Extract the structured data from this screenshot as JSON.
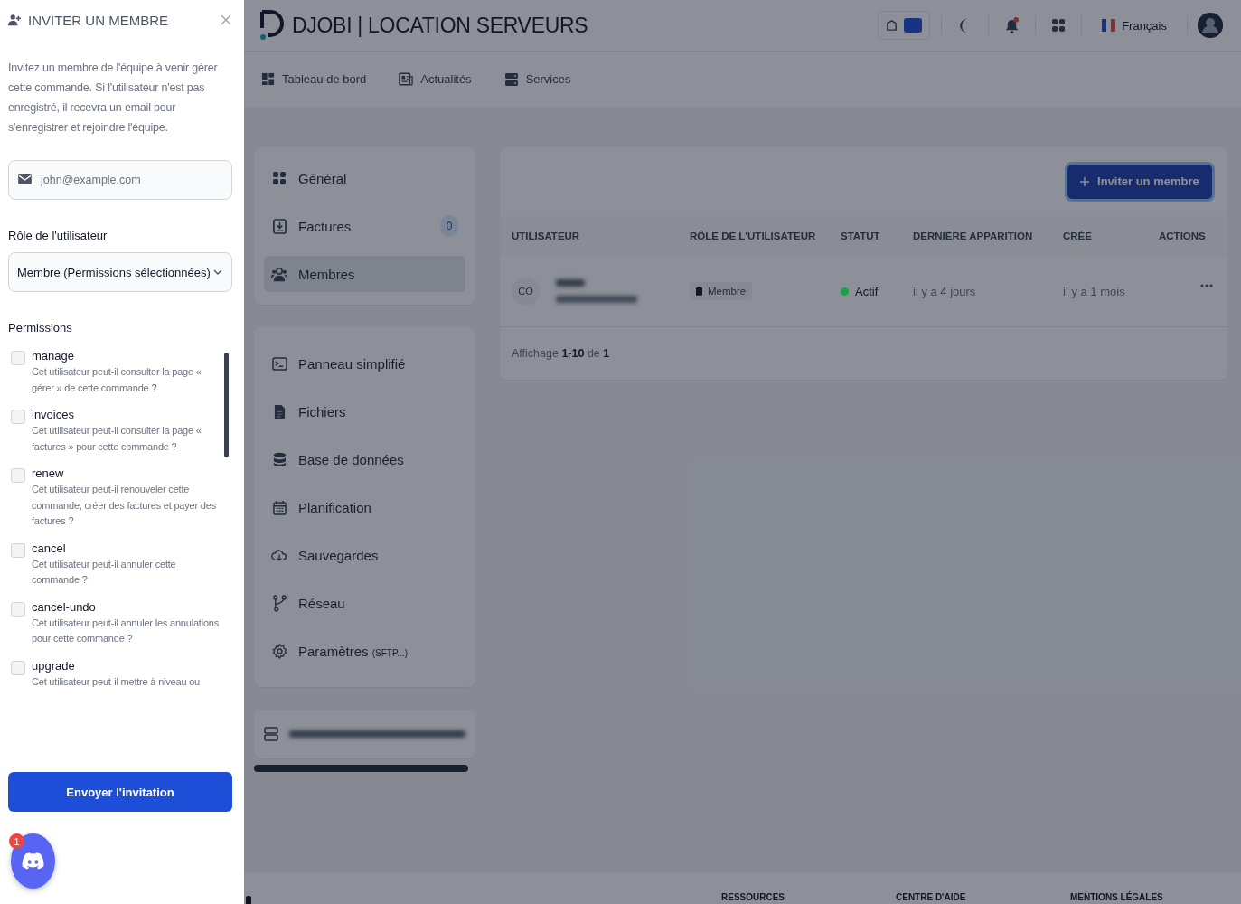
{
  "drawer": {
    "title": "INVITER UN MEMBRE",
    "description": "Invitez un membre de l'équipe à venir gérer cette commande. Si l'utilisateur n'est pas enregistré, il recevra un email pour s'enregistrer et rejoindre l'équipe.",
    "email_placeholder": "john@example.com",
    "role_label": "Rôle de l'utilisateur",
    "role_value": "Membre (Permissions sélectionnées)",
    "permissions_label": "Permissions",
    "permissions": [
      {
        "name": "manage",
        "description": "Cet utilisateur peut-il consulter la page « gérer » de cette commande ?",
        "checked": false
      },
      {
        "name": "invoices",
        "description": "Cet utilisateur peut-il consulter la page « factures » pour cette commande ?",
        "checked": false
      },
      {
        "name": "renew",
        "description": "Cet utilisateur peut-il renouveler cette commande, créer des factures et payer des factures ?",
        "checked": false
      },
      {
        "name": "cancel",
        "description": "Cet utilisateur peut-il annuler cette commande ?",
        "checked": false
      },
      {
        "name": "cancel-undo",
        "description": "Cet utilisateur peut-il annuler les annulations pour cette commande ?",
        "checked": false
      },
      {
        "name": "upgrade",
        "description": "Cet utilisateur peut-il mettre à niveau ou",
        "checked": false
      }
    ],
    "submit": "Envoyer l'invitation"
  },
  "chat_widget": {
    "badge": "1"
  },
  "header": {
    "brand": "DJOBI | LOCATION SERVEURS",
    "theme_toggle_on": true,
    "language": "Français"
  },
  "nav": [
    {
      "label": "Tableau de bord"
    },
    {
      "label": "Actualités"
    },
    {
      "label": "Services"
    }
  ],
  "sidebar": {
    "groups": [
      [
        {
          "label": "Général",
          "selected": false
        },
        {
          "label": "Factures",
          "badge": "0",
          "selected": false
        },
        {
          "label": "Membres",
          "selected": true
        }
      ],
      [
        {
          "label": "Panneau simplifié",
          "selected": false
        },
        {
          "label": "Fichiers",
          "selected": false
        },
        {
          "label": "Base de données",
          "selected": false
        },
        {
          "label": "Planification",
          "selected": false
        },
        {
          "label": "Sauvegardes",
          "selected": false
        },
        {
          "label": "Réseau",
          "selected": false
        },
        {
          "label": "Paramètres",
          "suffix": "(SFTP...)",
          "selected": false
        }
      ]
    ]
  },
  "members": {
    "invite_button": "Inviter un membre",
    "columns": [
      "UTILISATEUR",
      "RÔLE DE L'UTILISATEUR",
      "STATUT",
      "DERNIÈRE APPARITION",
      "CRÉE",
      "ACTIONS"
    ],
    "rows": [
      {
        "initials": "CO",
        "role": "Membre",
        "status": "Actif",
        "color": "#16a34a",
        "last_seen": "il y a 4 jours",
        "created": "il y a 1 mois"
      }
    ],
    "summary": "Affichage **1-10** de **1**"
  },
  "footer": {
    "links": [
      "RESSOURCES",
      "CENTRE D'AIDE",
      "MENTIONS LÉGALES"
    ]
  }
}
